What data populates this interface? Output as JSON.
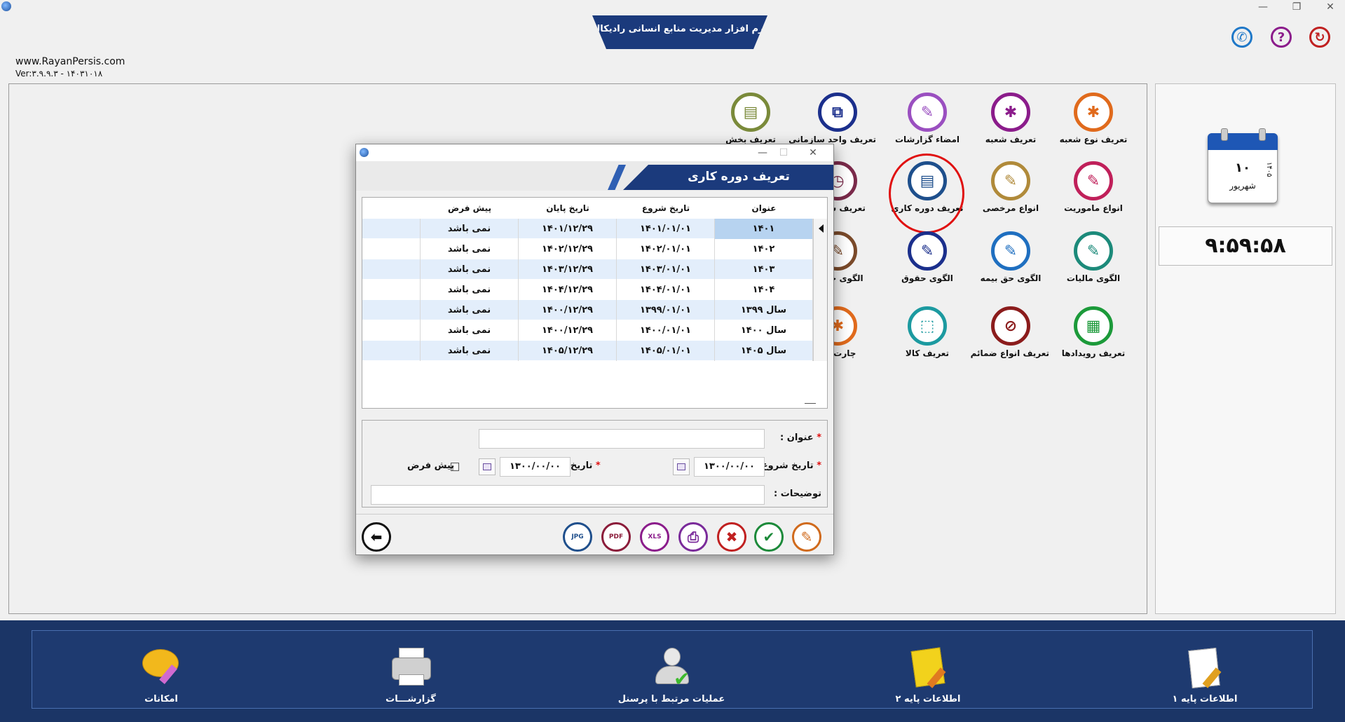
{
  "app": {
    "title": "نرم افزار مدیریت منابع انسانی رادیکال",
    "website": "www.RayanPersis.com",
    "version": "Ver:۳.۹.۹.۳ - ۱۴۰۳۱۰۱۸"
  },
  "top_icons": [
    {
      "name": "phone",
      "symbol": "✆",
      "color": "#1f78c8"
    },
    {
      "name": "help",
      "symbol": "?",
      "color": "#8b1c8b"
    },
    {
      "name": "exit",
      "symbol": "↻",
      "color": "#c02020"
    }
  ],
  "side": {
    "calendar": {
      "day": "۱۰",
      "month": "شهریور",
      "year": "۱۴۰۵"
    },
    "clock": "۹:۵۹:۵۸"
  },
  "grid_icons": {
    "row1": [
      {
        "label": "تعریف نوع شعبه",
        "color": "#e06a1c",
        "symbol": "✱"
      },
      {
        "label": "تعریف شعبه",
        "color": "#8b1c8b",
        "symbol": "✱"
      },
      {
        "label": "امضاء گزارشات",
        "color": "#9a4fc0",
        "symbol": "✎"
      },
      {
        "label": "تعریف واحد سازمانی",
        "color": "#1b2f8c",
        "symbol": "⧉"
      },
      {
        "label": "تعریف بخش",
        "color": "#7a8a3a",
        "symbol": "▤"
      }
    ],
    "row2": [
      {
        "label": "انواع ماموریت",
        "color": "#c0205a",
        "symbol": "✎"
      },
      {
        "label": "انواع مرخصی",
        "color": "#b08a3a",
        "symbol": "✎"
      },
      {
        "label": "تعریف دوره کاری",
        "color": "#1e4f8c",
        "symbol": "▤"
      },
      {
        "label": "تعریف شیفت",
        "color": "#7a2a4a",
        "symbol": "◷"
      }
    ],
    "row3": [
      {
        "label": "الگوی مالیات",
        "color": "#1c8a7a",
        "symbol": "✎"
      },
      {
        "label": "الگوی حق بیمه",
        "color": "#1f6fc0",
        "symbol": "✎"
      },
      {
        "label": "الگوی حقوق",
        "color": "#1b2f8c",
        "symbol": "✎"
      },
      {
        "label": "الگوی حضور",
        "color": "#7a4a2a",
        "symbol": "✎"
      }
    ],
    "row4": [
      {
        "label": "تعریف رویدادها",
        "color": "#1c9a3a",
        "symbol": "▦"
      },
      {
        "label": "تعریف انواع ضمائم",
        "color": "#8b1c1c",
        "symbol": "⊘"
      },
      {
        "label": "تعریف کالا",
        "color": "#1c9aa0",
        "symbol": "⬚"
      },
      {
        "label": "چارت س",
        "color": "#e06a1c",
        "symbol": "✱"
      }
    ]
  },
  "dialog": {
    "title": "تعریف دوره کاری",
    "columns": [
      "عنوان",
      "تاریخ شروع",
      "تاریخ پایان",
      "پیش فرض"
    ],
    "rows": [
      [
        "۱۴۰۱",
        "۱۴۰۱/۰۱/۰۱",
        "۱۴۰۱/۱۲/۲۹",
        "نمی باشد"
      ],
      [
        "۱۴۰۲",
        "۱۴۰۲/۰۱/۰۱",
        "۱۴۰۲/۱۲/۲۹",
        "نمی باشد"
      ],
      [
        "۱۴۰۳",
        "۱۴۰۳/۰۱/۰۱",
        "۱۴۰۳/۱۲/۲۹",
        "نمی باشد"
      ],
      [
        "۱۴۰۴",
        "۱۴۰۴/۰۱/۰۱",
        "۱۴۰۴/۱۲/۲۹",
        "نمی باشد"
      ],
      [
        "سال ۱۳۹۹",
        "۱۳۹۹/۰۱/۰۱",
        "۱۴۰۰/۱۲/۲۹",
        "نمی باشد"
      ],
      [
        "سال ۱۴۰۰",
        "۱۴۰۰/۰۱/۰۱",
        "۱۴۰۰/۱۲/۲۹",
        "نمی باشد"
      ],
      [
        "سال ۱۴۰۵",
        "۱۴۰۵/۰۱/۰۱",
        "۱۴۰۵/۱۲/۲۹",
        "نمی باشد"
      ]
    ],
    "form": {
      "title_label": "عنوان :",
      "title_value": "",
      "start_label": "تاریخ شروع :",
      "start_value": "۱۳۰۰/۰۰/۰۰",
      "end_label": "تاریخ پایان :",
      "end_value": "۱۳۰۰/۰۰/۰۰",
      "default_label": "پیش فرض",
      "desc_label": "توضیحات :",
      "desc_value": "",
      "required_mark": "*"
    },
    "toolbar": {
      "jpg": "JPG",
      "pdf": "PDF",
      "xls": "XLS"
    }
  },
  "bottom_menu": [
    {
      "label": "اطلاعات پایه ۱"
    },
    {
      "label": "اطلاعات پایه ۲"
    },
    {
      "label": "عملیات مرتبط با پرسنل"
    },
    {
      "label": "گزارشـــات"
    },
    {
      "label": "امکانات"
    }
  ]
}
